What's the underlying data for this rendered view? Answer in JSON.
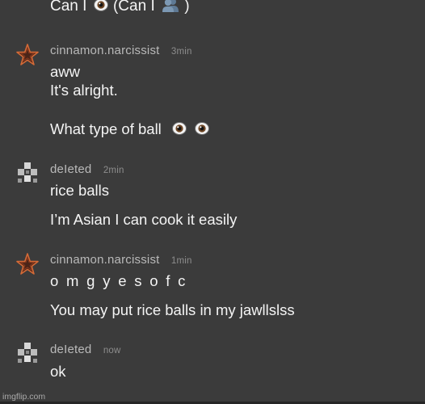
{
  "thread": {
    "top_line_prefix": "Can I",
    "top_line_middle": "(Can I",
    "top_line_suffix": ")",
    "posts": [
      {
        "username": "cinnamon.narcissist",
        "time": "3min",
        "avatar_icon": "star-icon",
        "lines": [
          "aww",
          "It's alright.",
          "What type of ball"
        ]
      },
      {
        "username": "deIeted",
        "time": "2min",
        "avatar_icon": "pixel-cross-icon",
        "lines": [
          "rice balls",
          "I’m Asian I can cook it easily"
        ]
      },
      {
        "username": "cinnamon.narcissist",
        "time": "1min",
        "avatar_icon": "star-icon",
        "lines": [
          "o m g y e s o f c",
          "You may put rice balls in my jawllslss"
        ]
      },
      {
        "username": "deIeted",
        "time": "now",
        "avatar_icon": "pixel-cross-icon",
        "lines": [
          "ok"
        ]
      }
    ]
  },
  "watermark": "imgflip.com",
  "colors": {
    "background": "#3b3b3b",
    "text": "#f4f4f4",
    "username": "#b9b9b9",
    "timestamp": "#8d8d8d"
  }
}
